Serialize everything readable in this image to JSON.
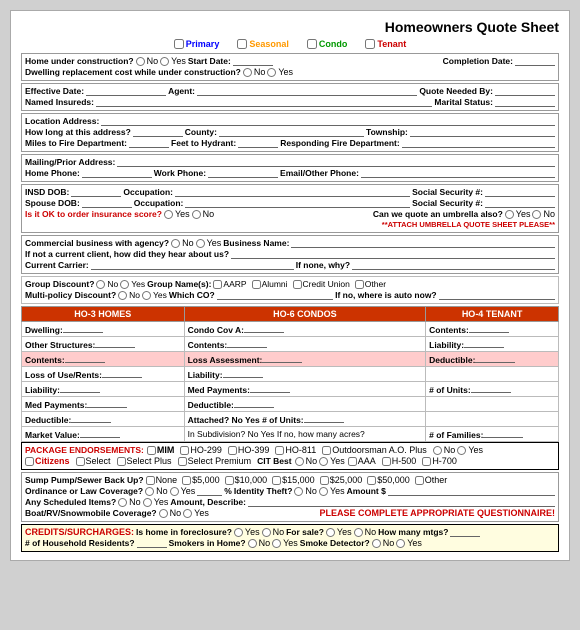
{
  "title": "Homeowners Quote Sheet",
  "checkboxes": [
    {
      "label": "Primary",
      "color": "primary-label"
    },
    {
      "label": "Seasonal",
      "color": "seasonal-label"
    },
    {
      "label": "Condo",
      "color": "condo-label"
    },
    {
      "label": "Tenant",
      "color": "tenant-label"
    }
  ],
  "construction": {
    "q1": "Home under construction?",
    "no1": "No",
    "yes1": "Yes",
    "start_date": "Start Date:",
    "completion_date": "Completion Date:",
    "q2": "Dwelling replacement cost while under construction?",
    "no2": "No",
    "yes2": "Yes"
  },
  "basic_info": {
    "effective_date": "Effective Date:",
    "agent": "Agent:",
    "quote_needed_by": "Quote Needed By:",
    "named_insureds": "Named Insureds:",
    "marital_status": "Marital Status:"
  },
  "location": {
    "label": "Location Address:",
    "how_long": "How long at this address?",
    "county": "County:",
    "township": "Township:",
    "miles_to_fire": "Miles to Fire Department:",
    "feet_to_hydrant": "Feet to Hydrant:",
    "responding_fire": "Responding Fire Department:"
  },
  "mailing": {
    "label": "Mailing/Prior Address:",
    "home_phone": "Home Phone:",
    "work_phone": "Work Phone:",
    "email": "Email/Other Phone:"
  },
  "personal": {
    "insd_dob": "INSD DOB:",
    "occupation": "Occupation:",
    "social1": "Social Security #:",
    "spouse_dob": "Spouse DOB:",
    "occupation2": "Occupation:",
    "social2": "Social Security #:",
    "order_score_q": "Is it OK to order insurance score?",
    "yes": "Yes",
    "no": "No",
    "umbrella_q": "Can we quote an umbrella also?",
    "yes2": "Yes",
    "no2": "No",
    "umbrella_note": "**ATTACH UMBRELLA QUOTE SHEET PLEASE**"
  },
  "commercial": {
    "q1": "Commercial business with agency?",
    "no": "No",
    "yes": "Yes",
    "business_name": "Business Name:",
    "q2": "If not a current client, how did they hear about us?",
    "current_carrier": "Current Carrier:",
    "if_none": "If none, why?"
  },
  "discounts": {
    "group_q": "Group Discount?",
    "no": "No",
    "yes": "Yes",
    "group_names": "Group Name(s):",
    "aarp": "AARP",
    "alumni": "Alumni",
    "credit_union": "Credit Union",
    "other": "Other",
    "multi_q": "Multi-policy Discount?",
    "no2": "No",
    "yes2": "Yes",
    "which_co": "Which CO?",
    "if_no": "If no, where is auto now?"
  },
  "coverage_table": {
    "col1_header": "HO-3 HOMES",
    "col2_header": "HO-6 CONDOS",
    "col3_header": "HO-4 TENANT",
    "rows": [
      [
        "Dwelling:",
        "Condo Cov A:",
        "Contents:"
      ],
      [
        "Other Structures:",
        "Contents:",
        "Liability:"
      ],
      [
        "Contents:",
        "Loss Assessment:",
        "Deductible:"
      ],
      [
        "Loss of Use/Rents:",
        "Liability:",
        ""
      ],
      [
        "Liability:",
        "Med Payments:",
        "# of Units:"
      ],
      [
        "Med Payments:",
        "Deductible:",
        ""
      ],
      [
        "Deductible:",
        "Attached? No  Yes  # of Units:",
        ""
      ],
      [
        "Market Value:",
        "In Subdivision? No  Yes  If no, how many acres?",
        "# of Families:"
      ]
    ]
  },
  "package": {
    "label": "PACKAGE ENDORSEMENTS:",
    "mim": "MIM",
    "options": [
      "HO-299",
      "HO-399",
      "HO-811",
      "Outdoorsman A.O. Plus",
      "No",
      "Yes"
    ],
    "row2": [
      "Citizens",
      "Select",
      "Select Plus",
      "Select Premium",
      "CIT Best",
      "No",
      "Yes",
      "AAA",
      "H-500",
      "H-700"
    ]
  },
  "sump": {
    "q": "Sump Pump/Sewer Back Up?",
    "none": "None",
    "amounts": [
      "$5,000",
      "$10,000",
      "$15,000",
      "$25,000",
      "$50,000",
      "Other"
    ],
    "ordinance_q": "Ordinance or Law Coverage?",
    "no": "No",
    "yes": "Yes",
    "pct": "%",
    "identity_q": "Identity Theft?",
    "no2": "No",
    "yes2": "Yes",
    "amount": "Amount $",
    "scheduled_q": "Any Scheduled Items?",
    "no3": "No",
    "yes3": "Yes",
    "amount_describe": "Amount, Describe:",
    "boat_q": "Boat/RV/Snowmobile Coverage?",
    "no4": "No",
    "yes4": "Yes",
    "complete_note": "PLEASE COMPLETE APPROPRIATE QUESTIONNAIRE!"
  },
  "credits": {
    "title": "CREDITS/SURCHARGES:",
    "foreclosure_q": "Is home in foreclosure?",
    "yes": "Yes",
    "no": "No",
    "forsale_q": "For sale?",
    "yes2": "Yes",
    "no2": "No",
    "how_many_mtgs": "How many mtgs?",
    "household_q": "# of Household Residents?",
    "smokers_q": "Smokers in Home?",
    "no3": "No",
    "yes3": "Yes",
    "smoke_detector_q": "Smoke Detector?",
    "no4": "No",
    "yes4": "Yes"
  }
}
